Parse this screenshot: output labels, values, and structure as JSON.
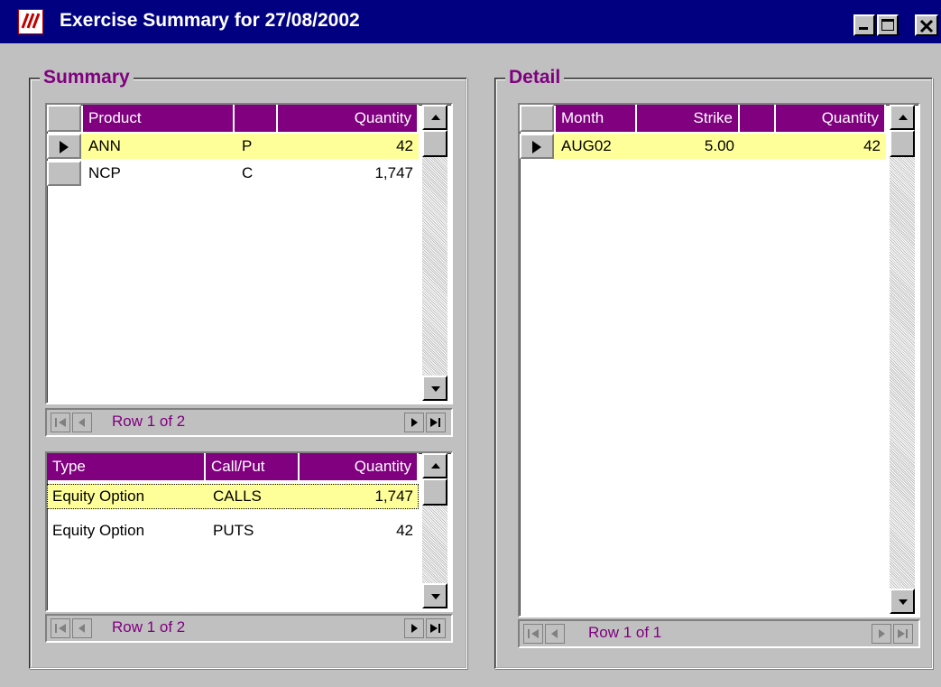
{
  "window": {
    "title": "Exercise Summary for 27/08/2002"
  },
  "summary": {
    "title": "Summary",
    "grid1": {
      "columns": [
        "Product",
        "",
        "Quantity"
      ],
      "rows": [
        {
          "product": "ANN",
          "pc": "P",
          "quantity": "42"
        },
        {
          "product": "NCP",
          "pc": "C",
          "quantity": "1,747"
        }
      ],
      "nav_text": "Row 1 of 2"
    },
    "grid2": {
      "columns": [
        "Type",
        "Call/Put",
        "Quantity"
      ],
      "rows": [
        {
          "type": "Equity Option",
          "callput": "CALLS",
          "quantity": "1,747"
        },
        {
          "type": "Equity Option",
          "callput": "PUTS",
          "quantity": "42"
        }
      ],
      "nav_text": "Row 1 of 2"
    }
  },
  "detail": {
    "title": "Detail",
    "grid": {
      "columns": [
        "Month",
        "Strike",
        "",
        "Quantity"
      ],
      "rows": [
        {
          "month": "AUG02",
          "strike": "5.00",
          "quantity": "42"
        }
      ],
      "nav_text": "Row 1 of 1"
    }
  },
  "colors": {
    "titlebar": "#000080",
    "header": "#800080",
    "selected_row": "#ffff99",
    "face": "#c0c0c0"
  }
}
